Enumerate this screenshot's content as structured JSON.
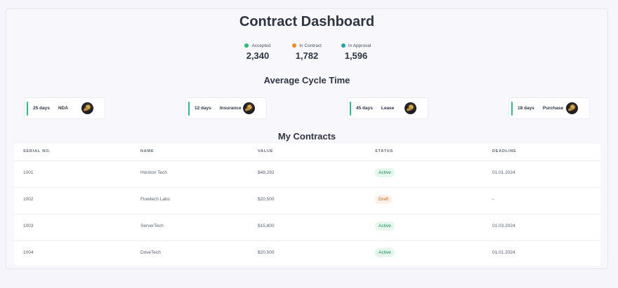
{
  "header": {
    "title": "Contract Dashboard"
  },
  "stats": [
    {
      "label": "Accepted",
      "value": "2,340",
      "color": "#1fbf6c"
    },
    {
      "label": "In Contract",
      "value": "1,782",
      "color": "#f28a1c"
    },
    {
      "label": "In Approval",
      "value": "1,596",
      "color": "#1aa3b5"
    }
  ],
  "cycle": {
    "title": "Average Cycle Time",
    "items": [
      {
        "days": "25 days",
        "type": "NDA"
      },
      {
        "days": "12 days",
        "type": "Insurance"
      },
      {
        "days": "45 days",
        "type": "Lease"
      },
      {
        "days": "18 days",
        "type": "Purchase"
      }
    ]
  },
  "contracts": {
    "title": "My Contracts",
    "columns": [
      "SERIAL NO.",
      "NAME",
      "VALUE",
      "STATUS",
      "DEADLINE"
    ],
    "rows": [
      {
        "serial": "1001",
        "name": "Horizon Tech",
        "value": "$48,292",
        "status": "Active",
        "status_kind": "active",
        "deadline": "01.01.2024"
      },
      {
        "serial": "1002",
        "name": "Flowtech Labs",
        "value": "$20,500",
        "status": "Draft",
        "status_kind": "draft",
        "deadline": "-"
      },
      {
        "serial": "1003",
        "name": "ServerTech",
        "value": "$15,800",
        "status": "Active",
        "status_kind": "active",
        "deadline": "01.03.2024"
      },
      {
        "serial": "1004",
        "name": "DoveTech",
        "value": "$20,500",
        "status": "Active",
        "status_kind": "active",
        "deadline": "01.01.2024"
      }
    ]
  }
}
